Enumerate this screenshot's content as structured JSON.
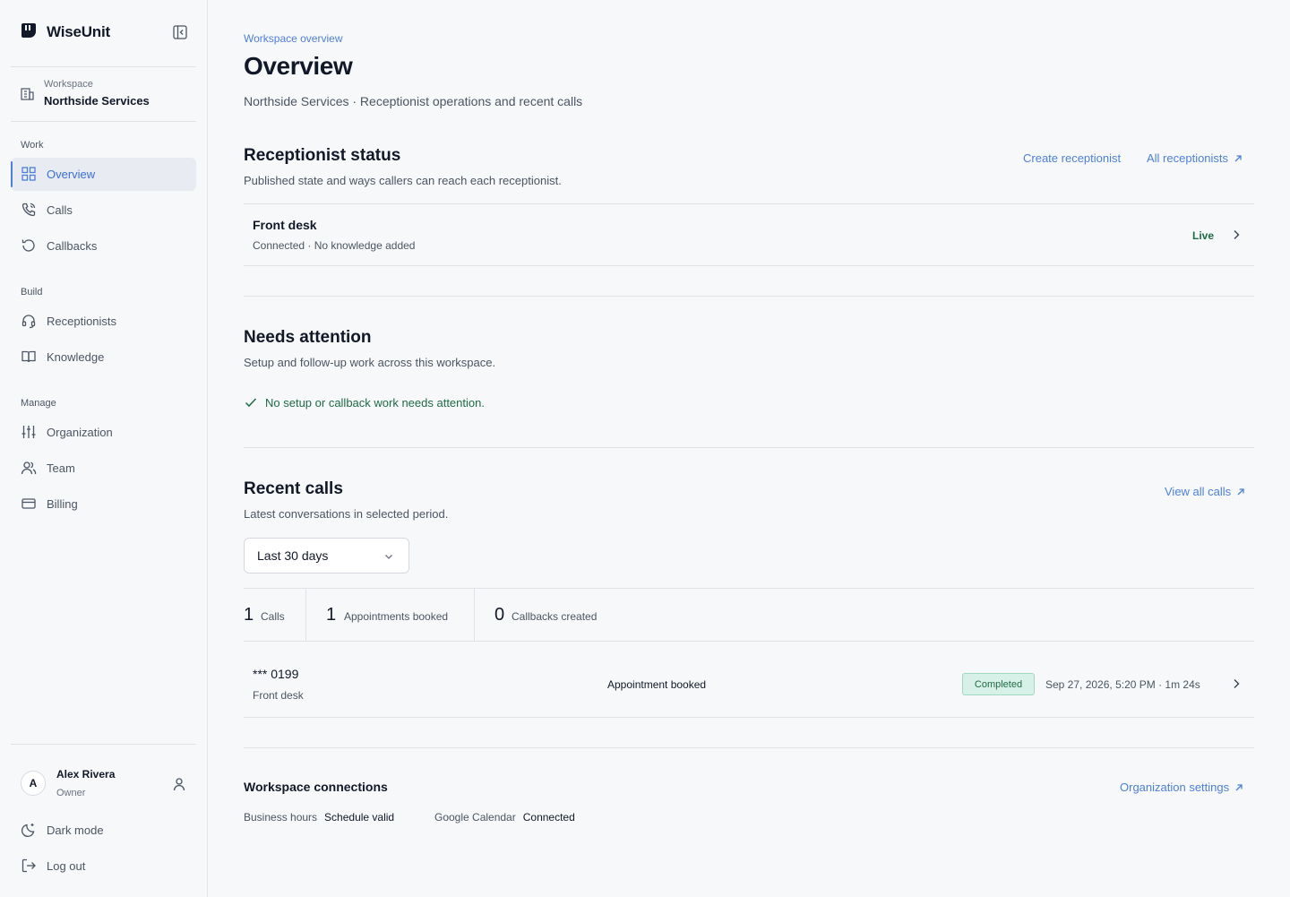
{
  "app": {
    "brand_name": "WiseUnit",
    "accent": "#4f7fd6"
  },
  "sidebar": {
    "workspace": {
      "label": "Workspace",
      "name": "Northside Services"
    },
    "sections": [
      {
        "title": "Work",
        "items": [
          {
            "label": "Overview",
            "icon": "grid-icon",
            "active": true
          },
          {
            "label": "Calls",
            "icon": "phone-icon"
          },
          {
            "label": "Callbacks",
            "icon": "history-icon"
          }
        ]
      },
      {
        "title": "Build",
        "items": [
          {
            "label": "Receptionists",
            "icon": "headset-icon"
          },
          {
            "label": "Knowledge",
            "icon": "book-icon"
          }
        ]
      },
      {
        "title": "Manage",
        "items": [
          {
            "label": "Organization",
            "icon": "sliders-icon"
          },
          {
            "label": "Team",
            "icon": "users-icon"
          },
          {
            "label": "Billing",
            "icon": "card-icon"
          }
        ]
      }
    ],
    "user": {
      "initial": "A",
      "name": "Alex Rivera",
      "role": "Owner"
    },
    "footer_items": [
      {
        "label": "Dark mode",
        "icon": "moon-icon"
      },
      {
        "label": "Log out",
        "icon": "logout-icon"
      }
    ]
  },
  "page": {
    "eyebrow": "Workspace overview",
    "title": "Overview",
    "subtitle": "Northside Services · Receptionist operations and recent calls"
  },
  "receptionist_status": {
    "title": "Receptionist status",
    "description": "Published state and ways callers can reach each receptionist.",
    "create_link": "Create receptionist",
    "all_link": "All receptionists",
    "items": [
      {
        "name": "Front desk",
        "detail": "Connected · No knowledge added",
        "status": "Live"
      }
    ]
  },
  "needs_attention": {
    "title": "Needs attention",
    "description": "Setup and follow-up work across this workspace.",
    "message": "No setup or callback work needs attention."
  },
  "recent_calls": {
    "title": "Recent calls",
    "description": "Latest conversations in selected period.",
    "view_all_link": "View all calls",
    "period": {
      "selected": "Last 30 days"
    },
    "stats": [
      {
        "value": "1",
        "label": "Calls"
      },
      {
        "value": "1",
        "label": "Appointments booked"
      },
      {
        "value": "0",
        "label": "Callbacks created"
      }
    ],
    "calls": [
      {
        "number": "*** 0199",
        "receptionist": "Front desk",
        "outcome": "Appointment booked",
        "status": "Completed",
        "meta": "Sep 27, 2026, 5:20 PM · 1m 24s"
      }
    ]
  },
  "connections": {
    "title": "Workspace connections",
    "settings_link": "Organization settings",
    "items": [
      {
        "key": "Business hours",
        "value": "Schedule valid"
      },
      {
        "key": "Google Calendar",
        "value": "Connected"
      }
    ]
  }
}
